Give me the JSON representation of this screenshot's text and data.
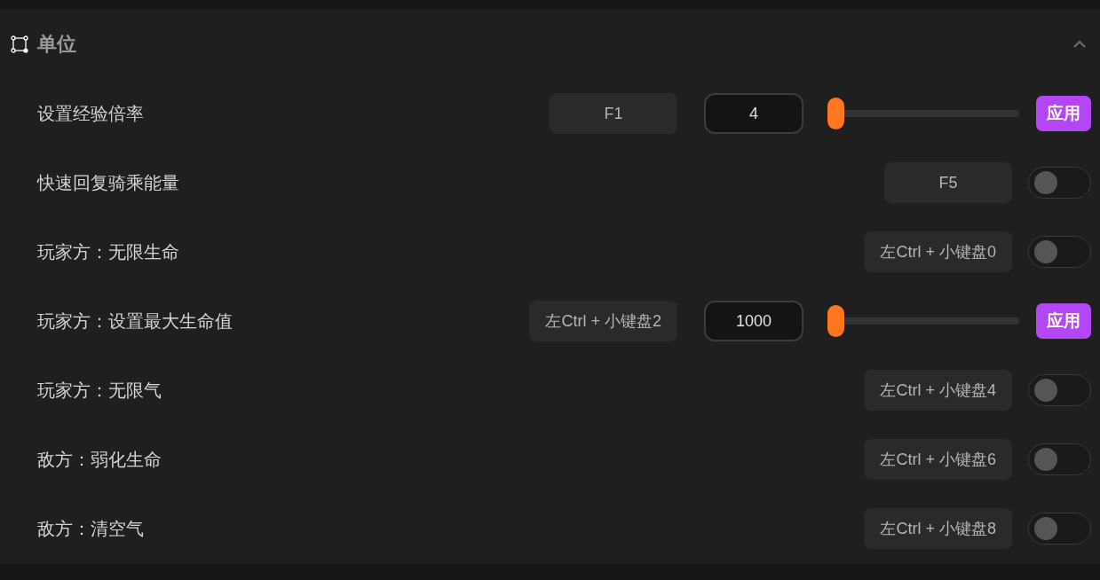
{
  "section": {
    "title": "单位",
    "expanded": true
  },
  "rows": [
    {
      "kind": "slider",
      "label": "设置经验倍率",
      "hotkey": "F1",
      "value": "4",
      "level": 0,
      "button": "应用"
    },
    {
      "kind": "toggle",
      "label": "快速回复骑乘能量",
      "hotkey": "F5",
      "on": false
    },
    {
      "kind": "toggle",
      "label": "玩家方：无限生命",
      "hotkey": "左Ctrl + 小键盘0",
      "on": false
    },
    {
      "kind": "slider",
      "label": "玩家方：设置最大生命值",
      "hotkey": "左Ctrl + 小键盘2",
      "value": "1000",
      "level": 0,
      "button": "应用"
    },
    {
      "kind": "toggle",
      "label": "玩家方：无限气",
      "hotkey": "左Ctrl + 小键盘4",
      "on": false
    },
    {
      "kind": "toggle",
      "label": "敌方：弱化生命",
      "hotkey": "左Ctrl + 小键盘6",
      "on": false
    },
    {
      "kind": "toggle",
      "label": "敌方：清空气",
      "hotkey": "左Ctrl + 小键盘8",
      "on": false
    }
  ]
}
